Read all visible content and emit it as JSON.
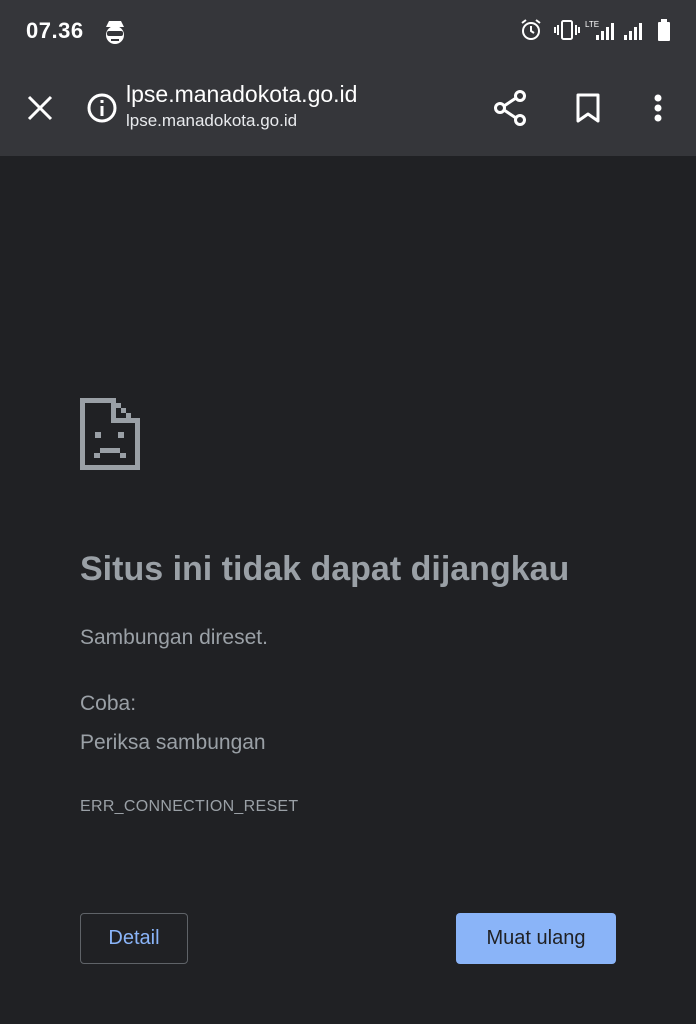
{
  "status_bar": {
    "time": "07.36",
    "network_label": "LTE",
    "icons": [
      "incognito-avatar-icon",
      "alarm-icon",
      "vibrate-icon",
      "lte-signal-icon",
      "signal-icon",
      "battery-icon"
    ]
  },
  "toolbar": {
    "title": "lpse.manadokota.go.id",
    "url": "lpse.manadokota.go.id",
    "icons": [
      "close-icon",
      "info-icon",
      "share-icon",
      "bookmark-icon",
      "more-vert-icon"
    ]
  },
  "error_page": {
    "icon": "sad-file-icon",
    "title": "Situs ini tidak dapat dijangkau",
    "description": "Sambungan direset.",
    "try_label": "Coba:",
    "suggestion": "Periksa sambungan",
    "error_code": "ERR_CONNECTION_RESET",
    "detail_label": "Detail",
    "reload_label": "Muat ulang"
  },
  "colors": {
    "toolbar_bg": "#35363a",
    "page_bg": "#202124",
    "text_muted": "#9aa0a6",
    "accent": "#8ab4f8"
  }
}
